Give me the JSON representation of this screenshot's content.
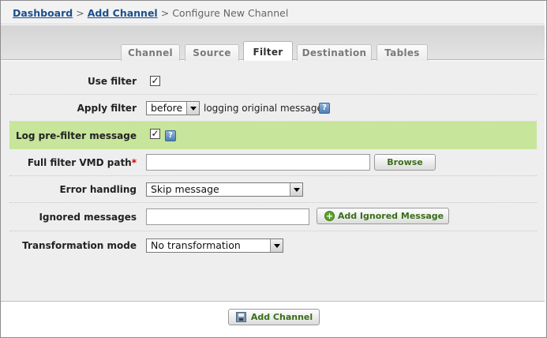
{
  "breadcrumb": {
    "items": [
      "Dashboard",
      "Add Channel"
    ],
    "separator": ">",
    "current": "Configure New Channel"
  },
  "tabs": [
    {
      "label": "Channel",
      "active": false
    },
    {
      "label": "Source",
      "active": false
    },
    {
      "label": "Filter",
      "active": true
    },
    {
      "label": "Destination",
      "active": false
    },
    {
      "label": "Tables",
      "active": false
    }
  ],
  "form": {
    "use_filter": {
      "label": "Use filter",
      "checked": true,
      "check_glyph": "✓"
    },
    "apply_filter": {
      "label": "Apply filter",
      "value": "before",
      "suffix": "logging original message",
      "help": "?"
    },
    "log_prefilter": {
      "label": "Log pre-filter message",
      "checked": true,
      "check_glyph": "✓",
      "help": "?"
    },
    "filter_path": {
      "label": "Full filter VMD path",
      "required_mark": "*",
      "value": "",
      "browse_label": "Browse"
    },
    "error_handling": {
      "label": "Error handling",
      "value": "Skip message"
    },
    "ignored_messages": {
      "label": "Ignored messages",
      "value": "",
      "add_label": "Add Ignored Message"
    },
    "transformation_mode": {
      "label": "Transformation mode",
      "value": "No transformation"
    }
  },
  "footer": {
    "add_channel_label": "Add Channel"
  },
  "colors": {
    "highlight_row": "#c7e59b",
    "link": "#1a4f8c",
    "button_text": "#3a6e1a"
  }
}
